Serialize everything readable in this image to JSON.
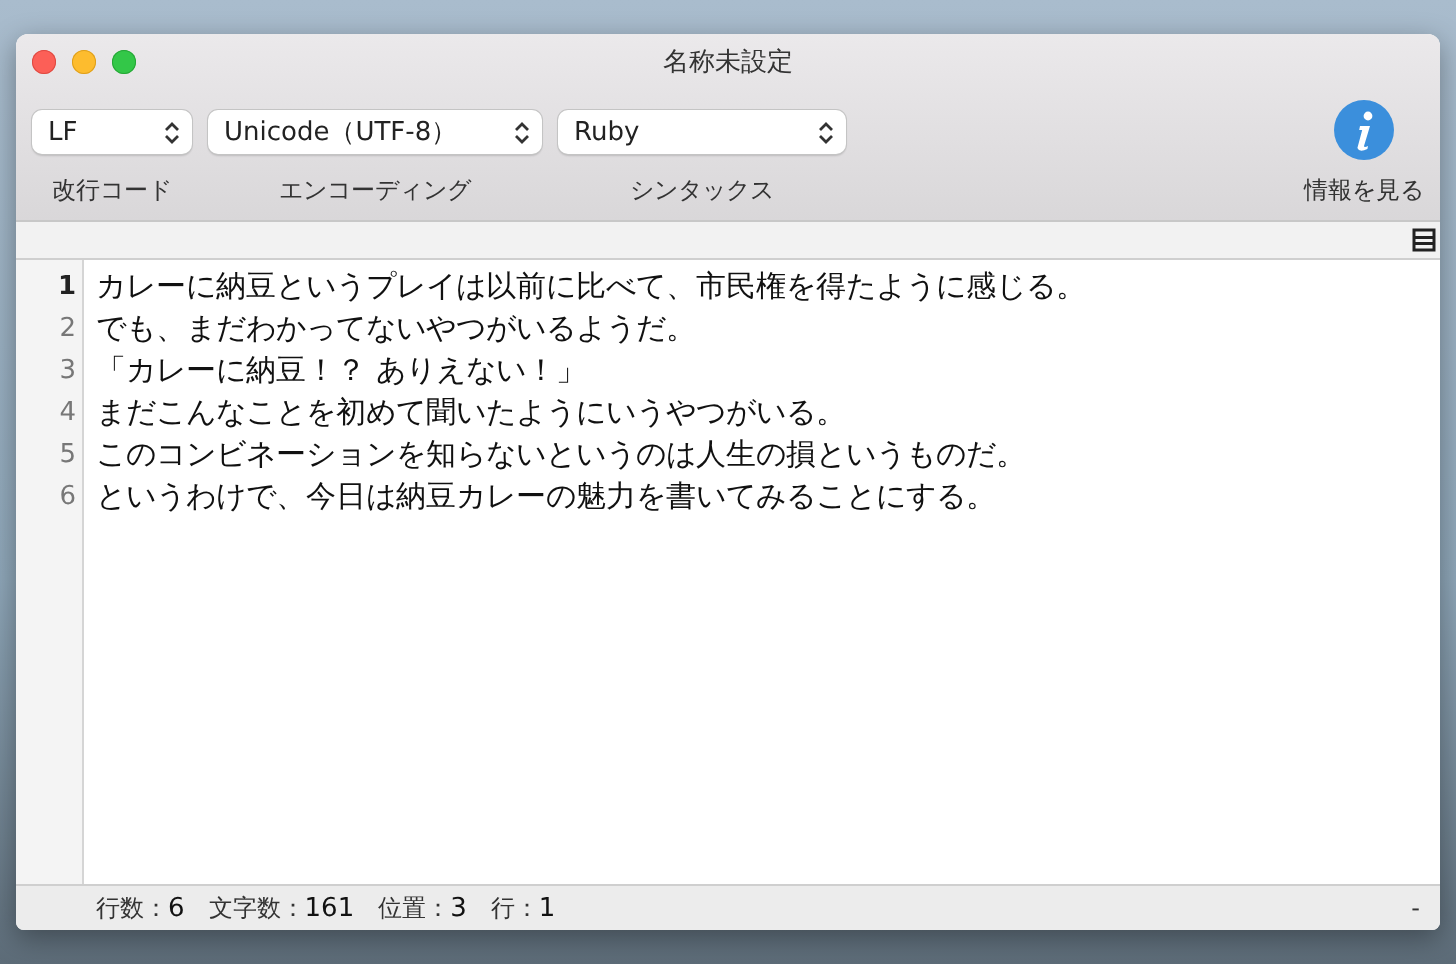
{
  "window": {
    "title": "名称未設定"
  },
  "toolbar": {
    "popups": [
      {
        "value": "LF",
        "label": "改行コード"
      },
      {
        "value": "Unicode（UTF-8）",
        "label": "エンコーディング"
      },
      {
        "value": "Ruby",
        "label": "シンタックス"
      }
    ],
    "info_button": {
      "label": "情報を見る"
    }
  },
  "editor": {
    "lines": [
      {
        "number": "1",
        "text": "カレーに納豆というプレイは以前に比べて、市民権を得たように感じる。",
        "current": true
      },
      {
        "number": "2",
        "text": "でも、まだわかってないやつがいるようだ。",
        "current": false
      },
      {
        "number": "3",
        "text": "「カレーに納豆！？ ありえない！」",
        "current": false
      },
      {
        "number": "4",
        "text": "まだこんなことを初めて聞いたようにいうやつがいる。",
        "current": false
      },
      {
        "number": "5",
        "text": "このコンビネーションを知らないというのは人生の損というものだ。",
        "current": false
      },
      {
        "number": "6",
        "text": "というわけで、今日は納豆カレーの魅力を書いてみることにする。",
        "current": false
      }
    ]
  },
  "status_bar": {
    "items": [
      {
        "label": "行数：",
        "value": "6"
      },
      {
        "label": "文字数：",
        "value": "161"
      },
      {
        "label": "位置：",
        "value": "3"
      },
      {
        "label": "行：",
        "value": "1"
      }
    ],
    "right": "-"
  }
}
